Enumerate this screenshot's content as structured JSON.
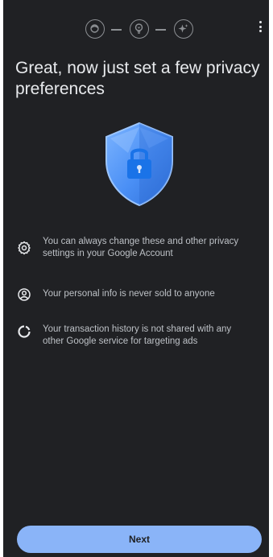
{
  "header": {
    "steps": [
      {
        "icon": "face-icon",
        "state": "active"
      },
      {
        "icon": "lightbulb-icon",
        "state": "pending"
      },
      {
        "icon": "sparkle-icon",
        "state": "pending"
      }
    ],
    "menu_icon": "more-vert-icon"
  },
  "main": {
    "title": "Great, now just set a few privacy preferences",
    "hero_icon": "shield-lock-icon",
    "items": [
      {
        "icon": "settings-icon",
        "text": "You can always change these and other privacy settings in your Google Account"
      },
      {
        "icon": "account-circle-icon",
        "text": "Your personal info is never sold to anyone"
      },
      {
        "icon": "donut-icon",
        "text": "Your transaction history is not shared with any other Google service for targeting ads"
      }
    ]
  },
  "footer": {
    "next_label": "Next"
  },
  "colors": {
    "background": "#202124",
    "text_primary": "#e8eaed",
    "text_secondary": "#bdc1c6",
    "accent": "#8ab4f8",
    "shield": "#4285f4"
  }
}
